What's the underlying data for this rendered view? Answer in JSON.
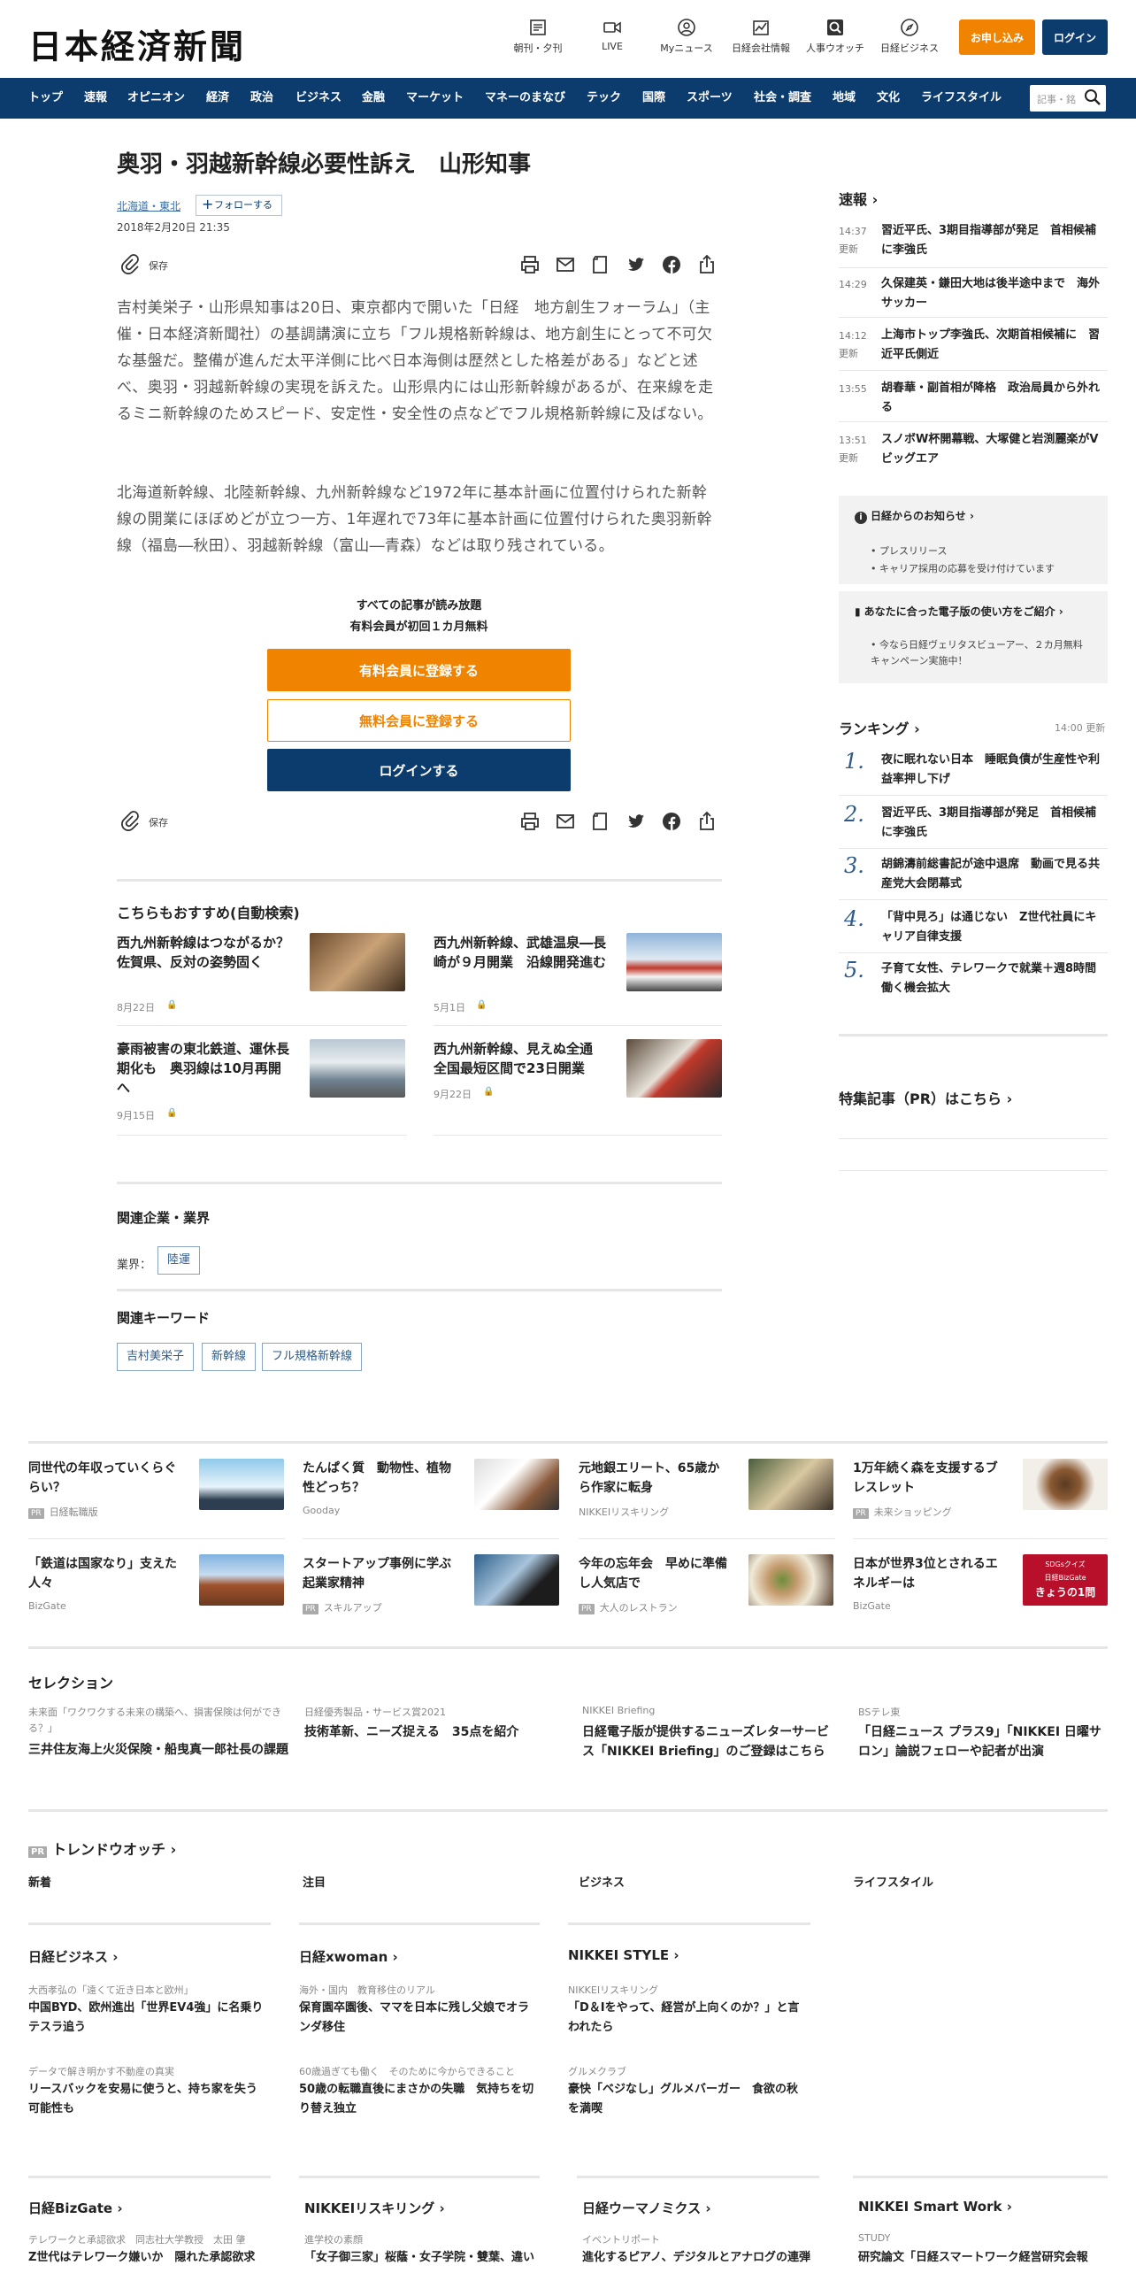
{
  "header": {
    "logo": "日本経済新聞",
    "icons": [
      {
        "label": "朝刊・夕刊",
        "icon": "newspaper-icon"
      },
      {
        "label": "LIVE",
        "icon": "video-icon"
      },
      {
        "label": "Myニュース",
        "icon": "user-icon"
      },
      {
        "label": "日経会社情報",
        "icon": "chart-icon"
      },
      {
        "label": "人事ウオッチ",
        "icon": "search-person-icon"
      },
      {
        "label": "日経ビジネス",
        "icon": "compass-icon"
      }
    ],
    "apply_label": "お申し込み",
    "login_label": "ログイン",
    "apply_color": "#f08300",
    "login_color": "#0c3c6e"
  },
  "nav": {
    "items": [
      "トップ",
      "速報",
      "オピニオン",
      "経済",
      "政治",
      "ビジネス",
      "金融",
      "マーケット",
      "マネーのまなび",
      "テック",
      "国際",
      "スポーツ",
      "社会・調査",
      "地域",
      "文化",
      "ライフスタイル"
    ],
    "search_placeholder": "記事・銘"
  },
  "article": {
    "title": "奥羽・羽越新幹線必要性訴え　山形知事",
    "region_tag": "北海道・東北",
    "follow_label": "フォローする",
    "date": "2018年2月20日 21:35",
    "save_label": "保存",
    "paragraphs": [
      "吉村美栄子・山形県知事は20日、東京都内で開いた「日経　地方創生フォーラム」（主催・日本経済新聞社）の基調講演に立ち「フル規格新幹線は、地方創生にとって不可欠な基盤だ。整備が進んだ太平洋側に比べ日本海側は歴然とした格差がある」などと述べ、奥羽・羽越新幹線の実現を訴えた。山形県内には山形新幹線があるが、在来線を走るミニ新幹線のためスピード、安定性・安全性の点などでフル規格新幹線に及ばない。",
      "北海道新幹線、北陸新幹線、九州新幹線など1972年に基本計画に位置付けられた新幹線の開業にほぼめどが立つ一方、1年遅れで73年に基本計画に位置付けられた奥羽新幹線（福島―秋田）、羽越新幹線（富山―青森）などは取り残されている。"
    ],
    "paywall": {
      "line1": "すべての記事が読み放題",
      "line2": "有料会員が初回１カ月無料",
      "paid_label": "有料会員に登録する",
      "free_label": "無料会員に登録する",
      "login_label": "ログインする"
    },
    "recommend": {
      "heading": "こちらもおすすめ(自動検索)",
      "items": [
        {
          "title": "西九州新幹線はつながるか？　佐賀県、反対の姿勢固く",
          "date": "8月22日"
        },
        {
          "title": "西九州新幹線、武雄温泉―長崎が９月開業　沿線開発進む",
          "date": "5月1日"
        },
        {
          "title": "豪雨被害の東北鉄道、運休長期化も　奥羽線は10月再開へ",
          "date": "9月15日"
        },
        {
          "title": "西九州新幹線、見えぬ全通　全国最短区間で23日開業",
          "date": "9月22日"
        }
      ]
    },
    "related_company": {
      "heading": "関連企業・業界",
      "industry_label": "業界：",
      "industry": "陸運"
    },
    "keywords": {
      "heading": "関連キーワード",
      "items": [
        "吉村美栄子",
        "新幹線",
        "フル規格新幹線"
      ]
    }
  },
  "sidebar": {
    "sokuhou_heading": "速報",
    "news": [
      {
        "time": "14:37",
        "updated": "更新",
        "title": "習近平氏、3期目指導部が発足　首相候補に李強氏"
      },
      {
        "time": "14:29",
        "updated": "",
        "title": "久保建英・鎌田大地は後半途中まで　海外サッカー"
      },
      {
        "time": "14:12",
        "updated": "更新",
        "title": "上海市トップ李強氏、次期首相候補に　習近平氏側近"
      },
      {
        "time": "13:55",
        "updated": "",
        "title": "胡春華・副首相が降格　政治局員から外れる"
      },
      {
        "time": "13:51",
        "updated": "更新",
        "title": "スノボW杯開幕戦、大塚健と岩渕麗楽がVビッグエア"
      }
    ],
    "notice": {
      "heading": "日経からのお知らせ",
      "items": [
        "プレスリリース",
        "キャリア採用の応募を受け付けています"
      ]
    },
    "digital": {
      "heading": "あなたに合った電子版の使い方をご紹介",
      "items": [
        "今なら日経ヴェリタスビューアー、２カ月無料キャンペーン実施中！"
      ]
    },
    "ranking": {
      "heading": "ランキング",
      "time": "14:00",
      "updated": "更新",
      "items": [
        {
          "rank": "1.",
          "title": "夜に眠れない日本　睡眠負債が生産性や利益率押し下げ"
        },
        {
          "rank": "2.",
          "title": "習近平氏、3期目指導部が発足　首相候補に李強氏"
        },
        {
          "rank": "3.",
          "title": "胡錦濤前総書記が途中退席　動画で見る共産党大会閉幕式"
        },
        {
          "rank": "4.",
          "title": "「背中見ろ」は通じない　Z世代社員にキャリア自律支援"
        },
        {
          "rank": "5.",
          "title": "子育て女性、テレワークで就業＋週8時間働く機会拡大"
        }
      ]
    },
    "feature_link": "特集記事（PR）はこちら"
  },
  "promo": {
    "items": [
      {
        "title": "同世代の年収っていくらぐらい？",
        "source": "日経転職版",
        "pr": true
      },
      {
        "title": "たんぱく質　動物性、植物性どっち？",
        "source": "Gooday",
        "pr": false
      },
      {
        "title": "元地銀エリート、65歳から作家に転身",
        "source": "NIKKEIリスキリング",
        "pr": false
      },
      {
        "title": "1万年続く森を支援するブレスレット",
        "source": "未来ショッピング",
        "pr": true
      },
      {
        "title": "「鉄道は国家なり」支えた人々",
        "source": "BizGate",
        "pr": false
      },
      {
        "title": "スタートアップ事例に学ぶ起業家精神",
        "source": "スキルアップ",
        "pr": true
      },
      {
        "title": "今年の忘年会　早めに準備し人気店で",
        "source": "大人のレストラン",
        "pr": true
      },
      {
        "title": "日本が世界3位とされるエネルギーは",
        "source": "BizGate",
        "pr": false
      }
    ],
    "sdgs_banner": {
      "line1": "SDGsクイズ",
      "line2": "日経BizGate",
      "line3": "きょうの1問"
    }
  },
  "selection": {
    "heading": "セレクション",
    "items": [
      {
        "kicker": "未来面「ワクワクする未来の構築へ、損害保険は何ができる？」",
        "title": "三井住友海上火災保険・船曳真一郎社長の課題"
      },
      {
        "kicker": "日経優秀製品・サービス賞2021",
        "title": "技術革新、ニーズ捉える　35点を紹介"
      },
      {
        "kicker": "NIKKEI Briefing",
        "title": "日経電子版が提供するニューズレターサービス「NIKKEI Briefing」のご登録はこちら"
      },
      {
        "kicker": "BSテレ東",
        "title": "「日経ニュース プラス9」「NIKKEI 日曜サロン」論説フェローや記者が出演"
      }
    ]
  },
  "trend": {
    "pr": "PR",
    "heading": "トレンドウオッチ",
    "tabs": [
      "新着",
      "注目",
      "ビジネス",
      "ライフスタイル"
    ]
  },
  "brands": [
    {
      "name": "日経ビジネス",
      "items": [
        {
          "kicker": "大西孝弘の「遠くて近き日本と欧州」",
          "title": "中国BYD、欧州進出「世界EV4強」に名乗り　テスラ追う"
        },
        {
          "kicker": "データで解き明かす不動産の真実",
          "title": "リースバックを安易に使うと、持ち家を失う可能性も"
        }
      ]
    },
    {
      "name": "日経xwoman",
      "items": [
        {
          "kicker": "海外・国内　教育移住のリアル",
          "title": "保育園卒園後、ママを日本に残し父娘でオランダ移住"
        },
        {
          "kicker": "60歳過ぎても働く　そのために今からできること",
          "title": "50歳の転職直後にまさかの失職　気持ちを切り替え独立"
        }
      ]
    },
    {
      "name": "NIKKEI STYLE",
      "items": [
        {
          "kicker": "NIKKEIリスキリング",
          "title": "「D＆Iをやって、経営が上向くのか？」と言われたら"
        },
        {
          "kicker": "グルメクラブ",
          "title": "豪快「ベジなし」グルメバーガー　食欲の秋を満喫"
        }
      ]
    }
  ],
  "brands2": [
    {
      "name": "日経BizGate",
      "kicker": "テレワークと承認欲求　同志社大学教授　太田 肇",
      "title": "Z世代はテレワーク嫌いか　隠れた承認欲求"
    },
    {
      "name": "NIKKEIリスキリング",
      "kicker": "進学校の素顔",
      "title": "「女子御三家」桜蔭・女子学院・雙葉、違い"
    },
    {
      "name": "日経ウーマノミクス",
      "kicker": "イベントリポート",
      "title": "進化するピアノ、デジタルとアナログの連弾"
    },
    {
      "name": "NIKKEI Smart Work",
      "kicker": "STUDY",
      "title": "研究論文「日経スマートワーク経営研究会報"
    }
  ]
}
